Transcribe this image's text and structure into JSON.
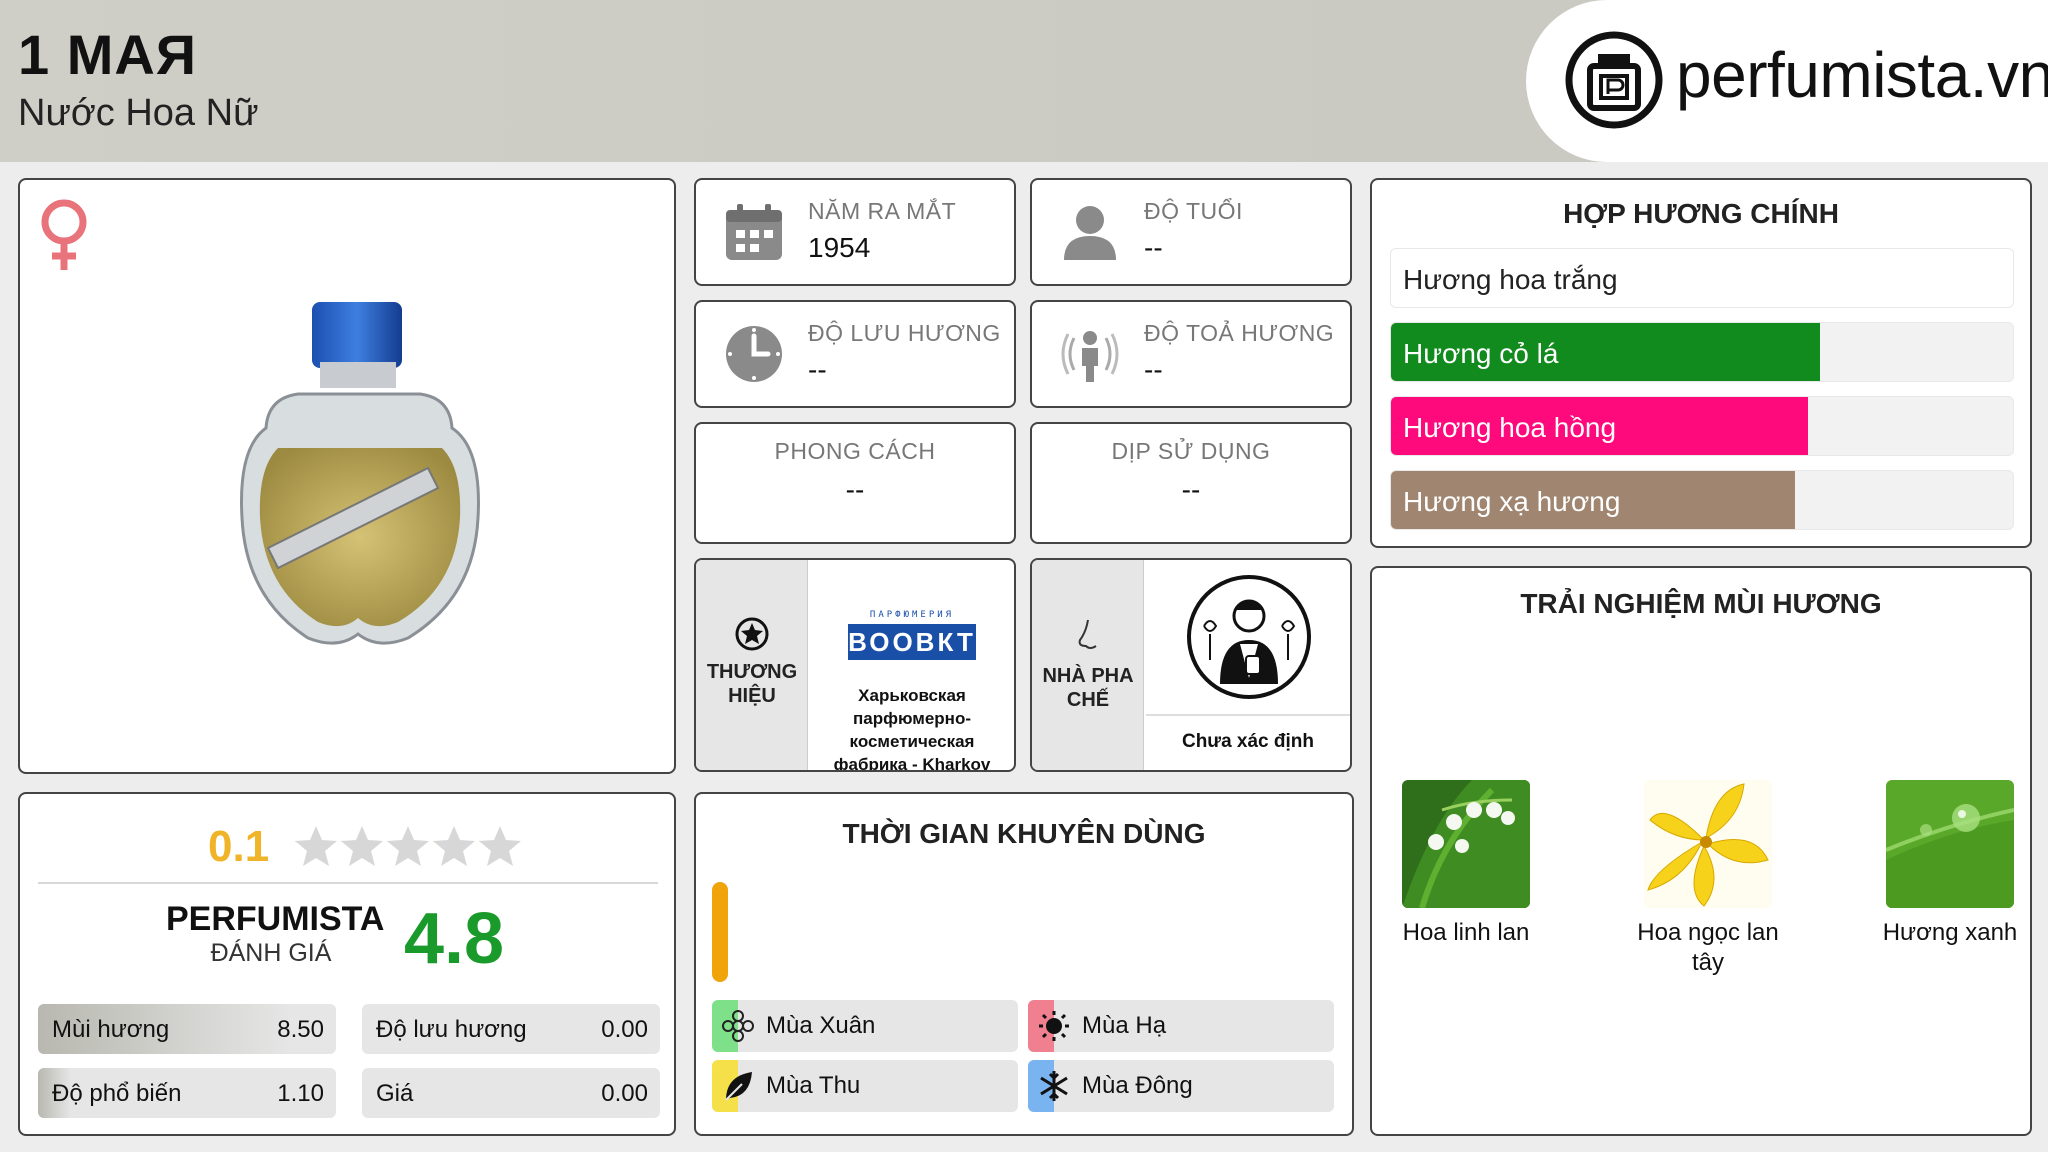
{
  "header": {
    "title": "1 MAЯ",
    "subtitle": "Nước Hoa Nữ",
    "logo_text": "perfumista.vn",
    "logo_icon": "perfume-bottle-logo-icon"
  },
  "product": {
    "gender_icon": "female-icon",
    "image": "perfume-bottle-image"
  },
  "rating": {
    "user_score": "0.1",
    "stars_filled_fraction": 0.02,
    "perfumista_label_1": "PERFUMISTA",
    "perfumista_label_2": "ĐÁNH GIÁ",
    "perfumista_score": "4.8",
    "metrics": [
      {
        "label": "Mùi hương",
        "value": "8.50",
        "fraction": 0.85
      },
      {
        "label": "Độ lưu hương",
        "value": "0.00",
        "fraction": 0.0
      },
      {
        "label": "Độ phổ biến",
        "value": "1.10",
        "fraction": 0.11
      },
      {
        "label": "Giá",
        "value": "0.00",
        "fraction": 0.0
      }
    ]
  },
  "info": {
    "release_year": {
      "label": "NĂM RA MẮT",
      "value": "1954",
      "icon": "calendar-icon"
    },
    "age": {
      "label": "ĐỘ TUỔI",
      "value": "--",
      "icon": "person-icon"
    },
    "longevity": {
      "label": "ĐỘ LƯU HƯƠNG",
      "value": "--",
      "icon": "clock-icon"
    },
    "sillage": {
      "label": "ĐỘ TOẢ HƯƠNG",
      "value": "--",
      "icon": "sillage-icon"
    },
    "style": {
      "label": "PHONG CÁCH",
      "value": "--"
    },
    "occasion": {
      "label": "DỊP SỬ DỤNG",
      "value": "--"
    },
    "brand": {
      "label_1": "THƯƠNG",
      "label_2": "HIỆU",
      "logo_text": "ПАРФЮМЕРИЯ",
      "logo_mark": "ВООВКТ",
      "name": "Харьковская парфюмерно-косметическая фабрика - Kharkov perfume"
    },
    "perfumer": {
      "label_1": "NHÀ PHA",
      "label_2": "CHẾ",
      "name": "Chưa xác định"
    }
  },
  "accords": {
    "title": "HỢP HƯƠNG CHÍNH",
    "items": [
      {
        "label": "Hương hoa trắng",
        "fraction": 1.0,
        "color": "#ffffff",
        "text_color": "#222222"
      },
      {
        "label": "Hương cỏ lá",
        "fraction": 0.69,
        "color": "#118a1e",
        "text_color": "#ffffff"
      },
      {
        "label": "Hương hoa hồng",
        "fraction": 0.67,
        "color": "#ff0a7c",
        "text_color": "#ffffff"
      },
      {
        "label": "Hương xạ hương",
        "fraction": 0.65,
        "color": "#a08670",
        "text_color": "#ffffff"
      }
    ]
  },
  "seasons": {
    "title": "THỜI GIAN KHUYÊN DÙNG",
    "bar_color": "#f0a30a",
    "items": [
      {
        "label": "Mùa Xuân",
        "color": "#7fe08a",
        "icon": "spring-flower-icon"
      },
      {
        "label": "Mùa Hạ",
        "color": "#f0808f",
        "icon": "summer-sun-icon"
      },
      {
        "label": "Mùa Thu",
        "color": "#f5e04a",
        "icon": "autumn-leaf-icon"
      },
      {
        "label": "Mùa Đông",
        "color": "#7ab4f0",
        "icon": "winter-snowflake-icon"
      }
    ]
  },
  "experience": {
    "title": "TRẢI NGHIỆM MÙI HƯƠNG",
    "notes": [
      {
        "label": "Hoa linh lan",
        "image": "lily-of-the-valley-image"
      },
      {
        "label": "Hoa ngọc lan tây",
        "image": "ylang-ylang-image"
      },
      {
        "label": "Hương xanh",
        "image": "green-leaf-image"
      }
    ]
  }
}
